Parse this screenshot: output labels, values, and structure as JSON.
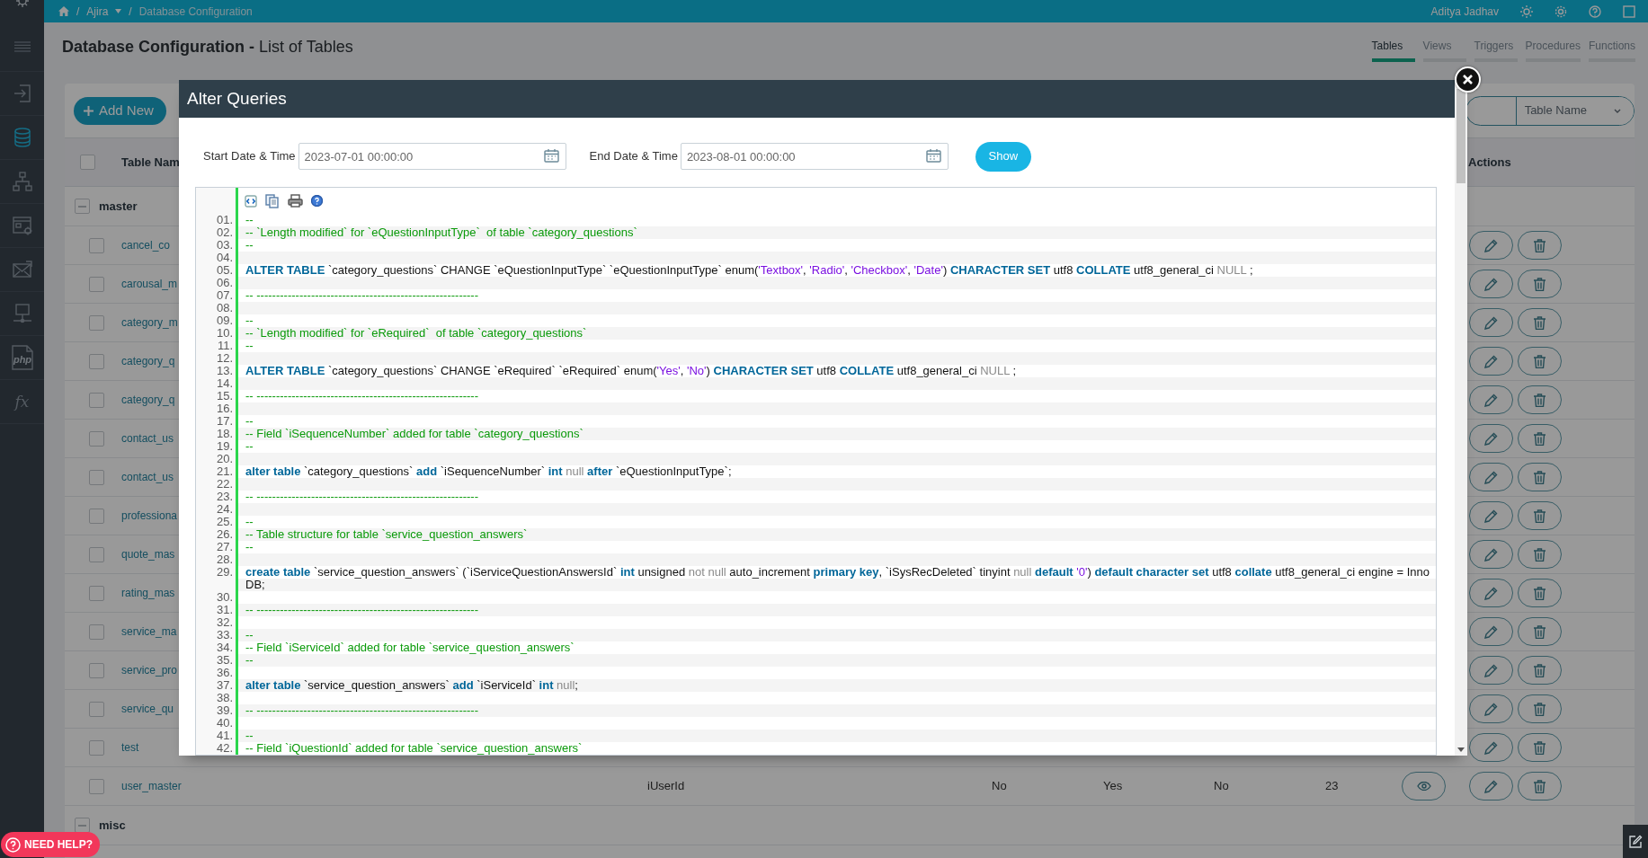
{
  "topbar": {
    "breadcrumb": [
      {
        "kind": "home"
      },
      {
        "kind": "menu",
        "prefix": "/",
        "label": "Ajira"
      },
      {
        "kind": "page",
        "prefix": "/",
        "label": "Database Configuration"
      }
    ],
    "user": "Aditya Jadhav"
  },
  "sidebar": {
    "items": [
      {
        "kind": "login",
        "selected": false
      },
      {
        "kind": "database",
        "selected": true
      },
      {
        "kind": "sitemap",
        "selected": false
      },
      {
        "kind": "settings",
        "selected": false
      },
      {
        "kind": "mail",
        "selected": false
      },
      {
        "kind": "network",
        "selected": false
      },
      {
        "kind": "php",
        "label": "php",
        "selected": false
      },
      {
        "kind": "function",
        "label": "fx",
        "selected": false
      }
    ]
  },
  "page": {
    "title": "**Database Configuration -** List of Tables"
  },
  "tabs": [
    {
      "label": "Tables",
      "selected": true
    },
    {
      "label": "Views",
      "selected": false
    },
    {
      "label": "Triggers",
      "selected": false
    },
    {
      "label": "Procedures",
      "selected": false
    },
    {
      "label": "Functions",
      "selected": false
    }
  ],
  "toolbar": {
    "add_button": "Add New",
    "filter_select": "Table Name"
  },
  "table": {
    "select_all_checked": false,
    "columns": [
      {
        "label": "Table Nam"
      },
      {
        "label": "Actions"
      }
    ],
    "groups": [
      {
        "name": "master",
        "expanded": true,
        "rows": [
          {
            "name": "cancel_co",
            "checked": false
          },
          {
            "name": "carousal_m",
            "checked": false
          },
          {
            "name": "category_m",
            "checked": false
          },
          {
            "name": "category_q",
            "checked": false
          },
          {
            "name": "category_q",
            "checked": false
          },
          {
            "name": "contact_us",
            "checked": false
          },
          {
            "name": "contact_us",
            "checked": false
          },
          {
            "name": "professiona",
            "checked": false
          },
          {
            "name": "quote_mas",
            "checked": false
          },
          {
            "name": "rating_mas",
            "checked": false
          },
          {
            "name": "service_ma",
            "checked": false
          },
          {
            "name": "service_pro",
            "checked": false
          },
          {
            "name": "service_qu",
            "checked": false
          },
          {
            "name": "test",
            "checked": false
          },
          {
            "name": "user_master",
            "checked": false,
            "column_3": "iUserId",
            "column_4": "No",
            "column_5": "Yes",
            "column_6": "No",
            "column_7": "23",
            "view": true
          }
        ]
      },
      {
        "name": "misc",
        "expanded": true
      }
    ]
  },
  "modal": {
    "title": "Alter Queries",
    "start_label": "Start Date & Time",
    "start_value": "2023-07-01 00:00:00",
    "end_label": "End Date & Time",
    "end_value": "2023-08-01 00:00:00",
    "show_button": "Show",
    "lines": [
      {
        "number": "01.",
        "tokens": [
          {
            "kind": "comment",
            "text": "--"
          }
        ]
      },
      {
        "number": "02.",
        "tokens": [
          {
            "kind": "comment",
            "text": "-- `Length modified` for `eQuestionInputType`  of table `category_questions`"
          }
        ]
      },
      {
        "number": "03.",
        "tokens": [
          {
            "kind": "comment",
            "text": "--"
          }
        ]
      },
      {
        "number": "04."
      },
      {
        "number": "05.",
        "tokens": [
          {
            "kind": "keyword",
            "text": "ALTER TABLE"
          },
          {
            "kind": "plain",
            "text": " `category_questions` CHANGE `eQuestionInputType` `eQuestionInputType` enum("
          },
          {
            "kind": "string",
            "text": "'Textbox'"
          },
          {
            "kind": "plain",
            "text": ", "
          },
          {
            "kind": "string",
            "text": "'Radio'"
          },
          {
            "kind": "plain",
            "text": ", "
          },
          {
            "kind": "string",
            "text": "'Checkbox'"
          },
          {
            "kind": "plain",
            "text": ", "
          },
          {
            "kind": "string",
            "text": "'Date'"
          },
          {
            "kind": "plain",
            "text": ") "
          },
          {
            "kind": "keyword",
            "text": "CHARACTER SET"
          },
          {
            "kind": "plain",
            "text": " utf8 "
          },
          {
            "kind": "keyword",
            "text": "COLLATE"
          },
          {
            "kind": "plain",
            "text": " utf8_general_ci "
          },
          {
            "kind": "null",
            "text": "NULL"
          },
          {
            "kind": "plain",
            "text": " ;"
          }
        ]
      },
      {
        "number": "06."
      },
      {
        "number": "07.",
        "tokens": [
          {
            "kind": "comment",
            "text": "-- ---------------------------------------------------------"
          }
        ]
      },
      {
        "number": "08."
      },
      {
        "number": "09.",
        "tokens": [
          {
            "kind": "comment",
            "text": "--"
          }
        ]
      },
      {
        "number": "10.",
        "tokens": [
          {
            "kind": "comment",
            "text": "-- `Length modified` for `eRequired`  of table `category_questions`"
          }
        ]
      },
      {
        "number": "11.",
        "tokens": [
          {
            "kind": "comment",
            "text": "--"
          }
        ]
      },
      {
        "number": "12."
      },
      {
        "number": "13.",
        "tokens": [
          {
            "kind": "keyword",
            "text": "ALTER TABLE"
          },
          {
            "kind": "plain",
            "text": " `category_questions` CHANGE `eRequired` `eRequired` enum("
          },
          {
            "kind": "string",
            "text": "'Yes'"
          },
          {
            "kind": "plain",
            "text": ", "
          },
          {
            "kind": "string",
            "text": "'No'"
          },
          {
            "kind": "plain",
            "text": ") "
          },
          {
            "kind": "keyword",
            "text": "CHARACTER SET"
          },
          {
            "kind": "plain",
            "text": " utf8 "
          },
          {
            "kind": "keyword",
            "text": "COLLATE"
          },
          {
            "kind": "plain",
            "text": " utf8_general_ci "
          },
          {
            "kind": "null",
            "text": "NULL"
          },
          {
            "kind": "plain",
            "text": " ;"
          }
        ]
      },
      {
        "number": "14."
      },
      {
        "number": "15.",
        "tokens": [
          {
            "kind": "comment",
            "text": "-- ---------------------------------------------------------"
          }
        ]
      },
      {
        "number": "16."
      },
      {
        "number": "17.",
        "tokens": [
          {
            "kind": "comment",
            "text": "--"
          }
        ]
      },
      {
        "number": "18.",
        "tokens": [
          {
            "kind": "comment",
            "text": "-- Field `iSequenceNumber` added for table `category_questions`"
          }
        ]
      },
      {
        "number": "19.",
        "tokens": [
          {
            "kind": "comment",
            "text": "--"
          }
        ]
      },
      {
        "number": "20."
      },
      {
        "number": "21.",
        "tokens": [
          {
            "kind": "keyword",
            "text": "alter table"
          },
          {
            "kind": "plain",
            "text": " `category_questions` "
          },
          {
            "kind": "keyword",
            "text": "add"
          },
          {
            "kind": "plain",
            "text": " `iSequenceNumber` "
          },
          {
            "kind": "keyword",
            "text": "int"
          },
          {
            "kind": "null",
            "text": " null"
          },
          {
            "kind": "keyword",
            "text": " after"
          },
          {
            "kind": "plain",
            "text": " `eQuestionInputType`;"
          }
        ]
      },
      {
        "number": "22."
      },
      {
        "number": "23.",
        "tokens": [
          {
            "kind": "comment",
            "text": "-- ---------------------------------------------------------"
          }
        ]
      },
      {
        "number": "24."
      },
      {
        "number": "25.",
        "tokens": [
          {
            "kind": "comment",
            "text": "--"
          }
        ]
      },
      {
        "number": "26.",
        "tokens": [
          {
            "kind": "comment",
            "text": "-- Table structure for table `service_question_answers`"
          }
        ]
      },
      {
        "number": "27.",
        "tokens": [
          {
            "kind": "comment",
            "text": "--"
          }
        ]
      },
      {
        "number": "28."
      },
      {
        "number": "29.",
        "tokens": [
          {
            "kind": "keyword",
            "text": "create table"
          },
          {
            "kind": "plain",
            "text": " `service_question_answers` (`iServiceQuestionAnswersId` "
          },
          {
            "kind": "keyword",
            "text": "int"
          },
          {
            "kind": "plain",
            "text": " unsigned "
          },
          {
            "kind": "null",
            "text": "not null"
          },
          {
            "kind": "plain",
            "text": " auto_increment "
          },
          {
            "kind": "keyword",
            "text": "primary key"
          },
          {
            "kind": "plain",
            "text": ", `iSysRecDeleted` tinyint "
          },
          {
            "kind": "null",
            "text": "null"
          },
          {
            "kind": "keyword",
            "text": " default"
          },
          {
            "kind": "string",
            "text": " '0'"
          },
          {
            "kind": "plain",
            "text": ") "
          },
          {
            "kind": "keyword",
            "text": "default character set"
          },
          {
            "kind": "plain",
            "text": " utf8 "
          },
          {
            "kind": "keyword",
            "text": "collate"
          },
          {
            "kind": "plain",
            "text": " utf8_general_ci engine = InnoDB;"
          }
        ]
      },
      {
        "number": "30."
      },
      {
        "number": "31.",
        "tokens": [
          {
            "kind": "comment",
            "text": "-- ---------------------------------------------------------"
          }
        ]
      },
      {
        "number": "32."
      },
      {
        "number": "33.",
        "tokens": [
          {
            "kind": "comment",
            "text": "--"
          }
        ]
      },
      {
        "number": "34.",
        "tokens": [
          {
            "kind": "comment",
            "text": "-- Field `iServiceId` added for table `service_question_answers`"
          }
        ]
      },
      {
        "number": "35.",
        "tokens": [
          {
            "kind": "comment",
            "text": "--"
          }
        ]
      },
      {
        "number": "36."
      },
      {
        "number": "37.",
        "tokens": [
          {
            "kind": "keyword",
            "text": "alter table"
          },
          {
            "kind": "plain",
            "text": " `service_question_answers` "
          },
          {
            "kind": "keyword",
            "text": "add"
          },
          {
            "kind": "plain",
            "text": " `iServiceId` "
          },
          {
            "kind": "keyword",
            "text": "int"
          },
          {
            "kind": "null",
            "text": " null"
          },
          {
            "kind": "plain",
            "text": ";"
          }
        ]
      },
      {
        "number": "38."
      },
      {
        "number": "39.",
        "tokens": [
          {
            "kind": "comment",
            "text": "-- ---------------------------------------------------------"
          }
        ]
      },
      {
        "number": "40."
      },
      {
        "number": "41.",
        "tokens": [
          {
            "kind": "comment",
            "text": "--"
          }
        ]
      },
      {
        "number": "42.",
        "tokens": [
          {
            "kind": "comment",
            "text": "-- Field `iQuestionId` added for table `service_question_answers`"
          }
        ]
      }
    ]
  },
  "help_button": "NEED HELP?"
}
